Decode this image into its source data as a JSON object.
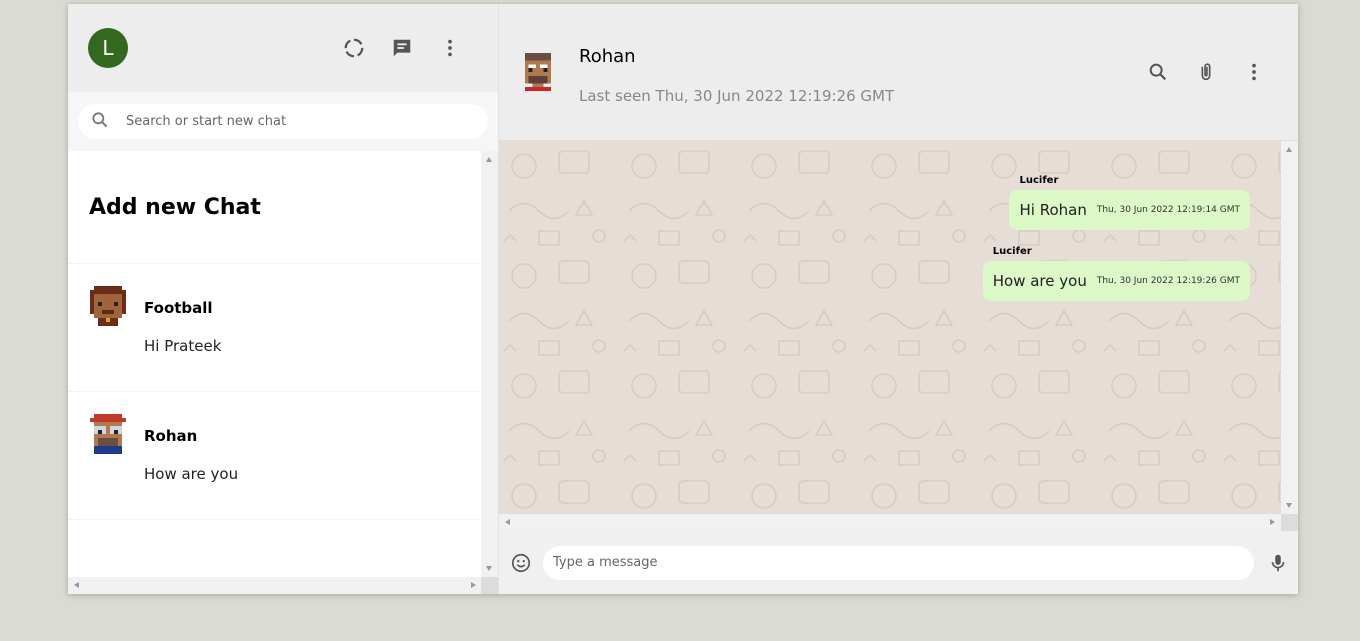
{
  "user": {
    "avatar_letter": "L",
    "avatar_color": "#33691e"
  },
  "sidebar": {
    "search_placeholder": "Search or start new chat",
    "add_chat_label": "Add new Chat",
    "chats": [
      {
        "name": "Football",
        "last_message": "Hi Prateek"
      },
      {
        "name": "Rohan",
        "last_message": "How are you"
      }
    ]
  },
  "conversation": {
    "name": "Rohan",
    "last_seen": "Last seen Thu, 30 Jun 2022 12:19:26 GMT",
    "messages": [
      {
        "sender": "Lucifer",
        "text": "Hi Rohan",
        "timestamp": "Thu, 30 Jun 2022 12:19:14 GMT"
      },
      {
        "sender": "Lucifer",
        "text": "How are you",
        "timestamp": "Thu, 30 Jun 2022 12:19:26 GMT"
      }
    ]
  },
  "footer": {
    "input_placeholder": "Type a message"
  },
  "colors": {
    "bubble": "#dcf8c6",
    "chat_bg": "#e5ddd5",
    "header_bg": "#ededed"
  }
}
